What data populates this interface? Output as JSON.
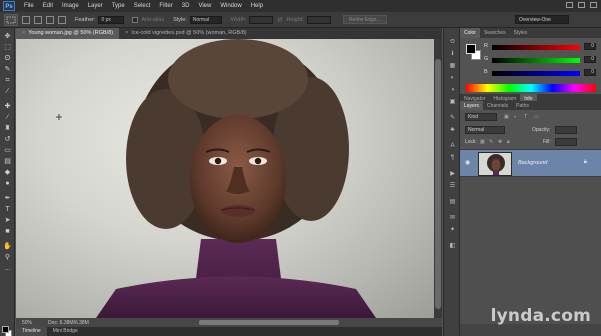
{
  "menubar": {
    "logo": "Ps",
    "items": [
      "File",
      "Edit",
      "Image",
      "Layer",
      "Type",
      "Select",
      "Filter",
      "3D",
      "View",
      "Window",
      "Help"
    ]
  },
  "options": {
    "feather_label": "Feather:",
    "feather_value": "0 px",
    "antialias_label": "Anti-alias",
    "style_label": "Style:",
    "style_value": "Normal",
    "width_label": "Width:",
    "height_label": "Height:",
    "refine_label": "Refine Edge...",
    "workspace_value": "Overview-One"
  },
  "document": {
    "tabs": [
      {
        "label": "Young woman.jpg @ 50% (RGB/8)",
        "active": true
      },
      {
        "label": "Ice-cold vignettes.psd @ 50% (woman, RGB/8)",
        "active": false
      }
    ],
    "zoom": "50%",
    "doc_size": "Doc: 6.38M/6.38M"
  },
  "bottom_tabs": [
    "Timeline",
    "Mini Bridge"
  ],
  "color_panel": {
    "tabs": [
      "Color",
      "Swatches",
      "Styles"
    ],
    "channels": [
      {
        "label": "R",
        "value": "0"
      },
      {
        "label": "G",
        "value": "0"
      },
      {
        "label": "B",
        "value": "0"
      }
    ]
  },
  "layers_panel": {
    "tabs": [
      "Layers",
      "Channels",
      "Paths"
    ],
    "kind_value": "Kind",
    "blend_value": "Normal",
    "opacity_label": "Opacity:",
    "fill_label": "Fill:",
    "lock_label": "Lock:",
    "layers": [
      {
        "name": "Background",
        "locked": true
      }
    ]
  },
  "info_tabs": [
    "Navigator",
    "Histogram",
    "Info"
  ],
  "watermark": "lynda.com"
}
